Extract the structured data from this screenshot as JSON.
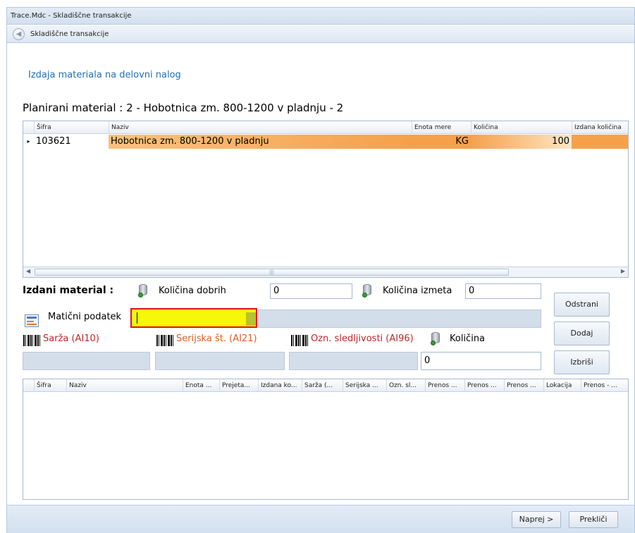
{
  "window": {
    "title": "Trace.Mdc - Skladiščne transakcije"
  },
  "nav": {
    "title": "Skladiščne transakcije",
    "back_icon": "back-arrow-icon"
  },
  "page": {
    "heading": "Izdaja materiala na delovni nalog",
    "planned_title": "Planirani material : 2 - Hobotnica zm. 800-1200 v pladnju - 2"
  },
  "planned_grid": {
    "columns": [
      "Šifra",
      "Naziv",
      "Enota mere",
      "Količina",
      "Izdana količina"
    ],
    "rows": [
      {
        "sifra": "103621",
        "naziv": "Hobotnica zm. 800-1200 v pladnju",
        "enota": "KG",
        "kolicina": "100",
        "izdana": ""
      }
    ],
    "highlight_color": "#f7a04a"
  },
  "issued": {
    "label": "Izdani material :",
    "good_qty_label": "Količina dobrih",
    "good_qty_value": "0",
    "waste_qty_label": "Količina izmeta",
    "waste_qty_value": "0",
    "master_label": "Matični podatek",
    "master_value": "",
    "lot_label": "Sarža (AI10)",
    "serial_label": "Serijska št. (AI21)",
    "trace_label": "Ozn. sledljivosti (AI96)",
    "qty_label": "Količina",
    "qty_value": "0"
  },
  "buttons": {
    "remove": "Odstrani",
    "add": "Dodaj",
    "delete": "Izbriši",
    "next": "Naprej >",
    "cancel": "Prekliči"
  },
  "issued_grid": {
    "columns": [
      "Šifra",
      "Naziv",
      "Enota ...",
      "Prejeta...",
      "Izdana ko...",
      "Sarža (...",
      "Serijska ...",
      "Ozn. sl...",
      "Prenos ...",
      "Prenos ...",
      "Prenos ...",
      "Lokacija",
      "Prenos - ..."
    ]
  },
  "colors": {
    "accent_link": "#1e6fb5",
    "label_red": "#c0262b",
    "label_orange": "#d9601f",
    "focus_yellow": "#f7f70a",
    "focus_border": "#e0121a"
  }
}
